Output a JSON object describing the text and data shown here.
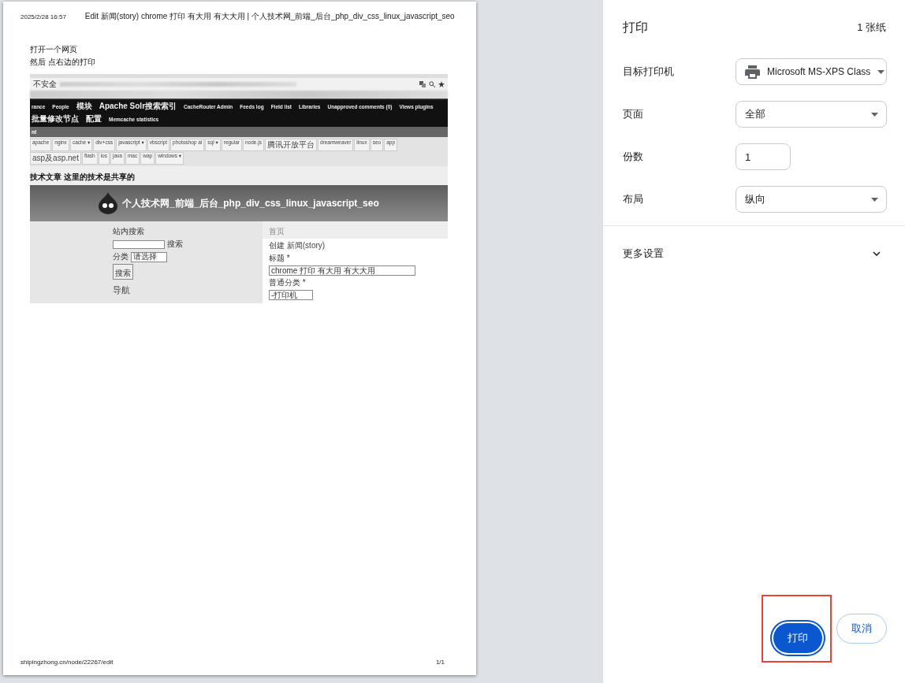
{
  "preview": {
    "header_date": "2025/2/28 16:57",
    "header_title": "Edit 新闻(story) chrome 打印 有大用 有大大用 | 个人技术网_前端_后台_php_div_css_linux_javascript_seo",
    "body_lines": [
      "打开一个网页",
      "然后 点右边的打印"
    ],
    "embedded": {
      "address_label": "不安全",
      "nav_items": [
        "rance",
        "People",
        "模块",
        "Apache Solr搜索索引",
        "CacheRouter Admin",
        "Feeds log",
        "Field list",
        "Libraries",
        "Unapproved comments (0)",
        "Views plugins",
        "批量修改节点",
        "配置",
        "Memcache statistics"
      ],
      "sub_bar": "nt",
      "tags": [
        "apache",
        "nginx",
        "cache ▾",
        "div+css",
        "javascript ▾",
        "vbscript",
        "photoshop ai",
        "sql ▾",
        "regular",
        "node.js",
        "腾讯开放平台",
        "dreamweaver",
        "linux",
        "seo",
        "app",
        "asp及asp.net",
        "flash",
        "ios",
        "java",
        "mac",
        "wap",
        "windows ▾"
      ],
      "heading": "技术文章 这里的技术是共享的",
      "site_title": "个人技术网_前端_后台_php_div_css_linux_javascript_seo",
      "sidebar": {
        "search_label": "站内搜索",
        "search_button": "搜索",
        "category_label": "分类",
        "category_value": "请选择",
        "submit": "搜索",
        "nav_title": "导航"
      },
      "breadcrumb": "首页",
      "page_title": "创建 新闻(story)",
      "title_label": "标题 *",
      "title_value": "chrome 打印 有大用 有大大用",
      "category_label": "普通分类 *",
      "category_value": "-打印机"
    },
    "footer_url": "shipingzhong.cn/node/22267/edit",
    "footer_page": "1/1"
  },
  "panel": {
    "title": "打印",
    "sheets": "1 张纸",
    "settings": [
      {
        "kind": "printer-select",
        "label": "目标打印机",
        "value": "Microsoft MS-XPS Class"
      },
      {
        "kind": "select",
        "label": "页面",
        "value": "全部"
      },
      {
        "kind": "input",
        "label": "份数",
        "value": "1"
      },
      {
        "kind": "select",
        "label": "布局",
        "value": "纵向"
      }
    ],
    "more_settings": {
      "label": "更多设置",
      "expanded": false
    },
    "buttons": [
      {
        "label": "打印",
        "kind": "primary",
        "highlighted": true
      },
      {
        "label": "取消",
        "kind": "secondary",
        "highlighted": false
      }
    ]
  }
}
